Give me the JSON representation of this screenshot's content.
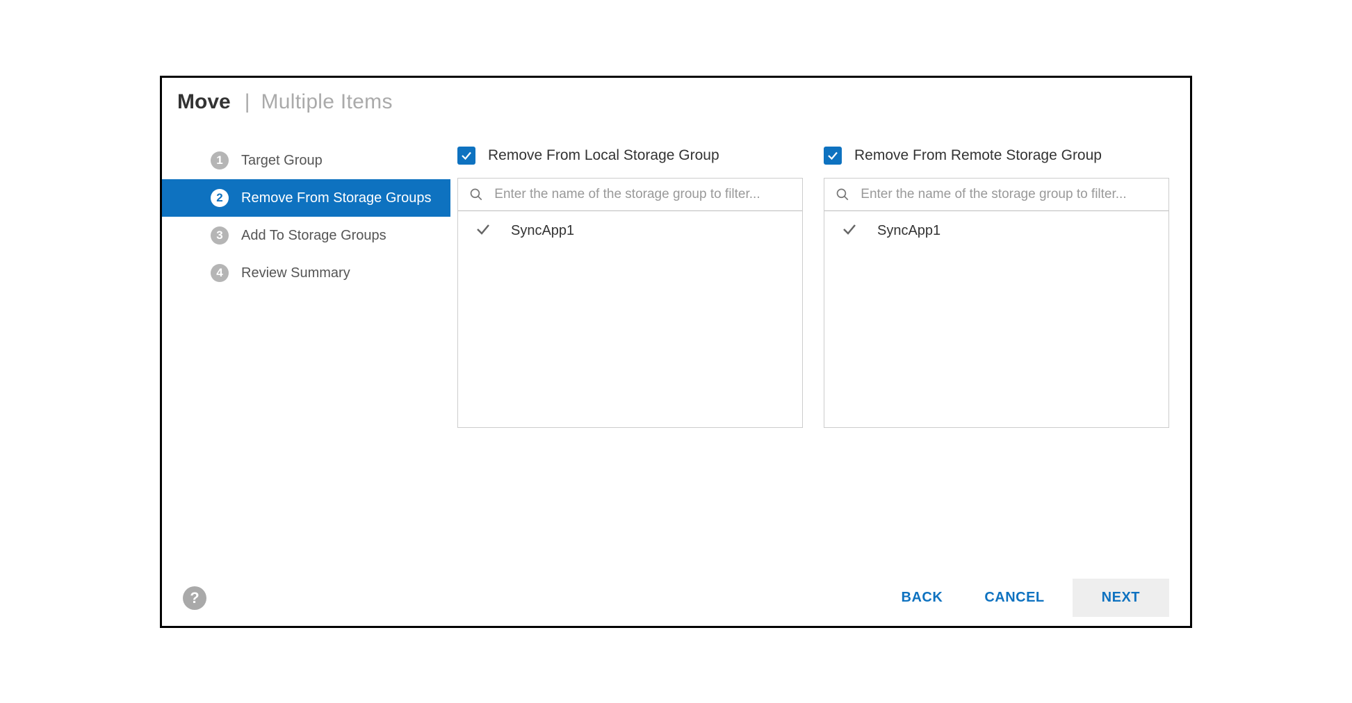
{
  "header": {
    "title": "Move",
    "subtitle": "Multiple Items"
  },
  "steps": [
    {
      "num": "1",
      "label": "Target Group",
      "active": false
    },
    {
      "num": "2",
      "label": "Remove From Storage Groups",
      "active": true
    },
    {
      "num": "3",
      "label": "Add To Storage Groups",
      "active": false
    },
    {
      "num": "4",
      "label": "Review Summary",
      "active": false
    }
  ],
  "panels": {
    "local": {
      "checkbox_checked": true,
      "label": "Remove From Local Storage Group",
      "search_placeholder": "Enter the name of the storage group to filter...",
      "items": [
        {
          "name": "SyncApp1",
          "selected": true
        }
      ]
    },
    "remote": {
      "checkbox_checked": true,
      "label": "Remove From Remote Storage Group",
      "search_placeholder": "Enter the name of the storage group to filter...",
      "items": [
        {
          "name": "SyncApp1",
          "selected": true
        }
      ]
    }
  },
  "footer": {
    "back": "BACK",
    "cancel": "CANCEL",
    "next": "NEXT"
  }
}
